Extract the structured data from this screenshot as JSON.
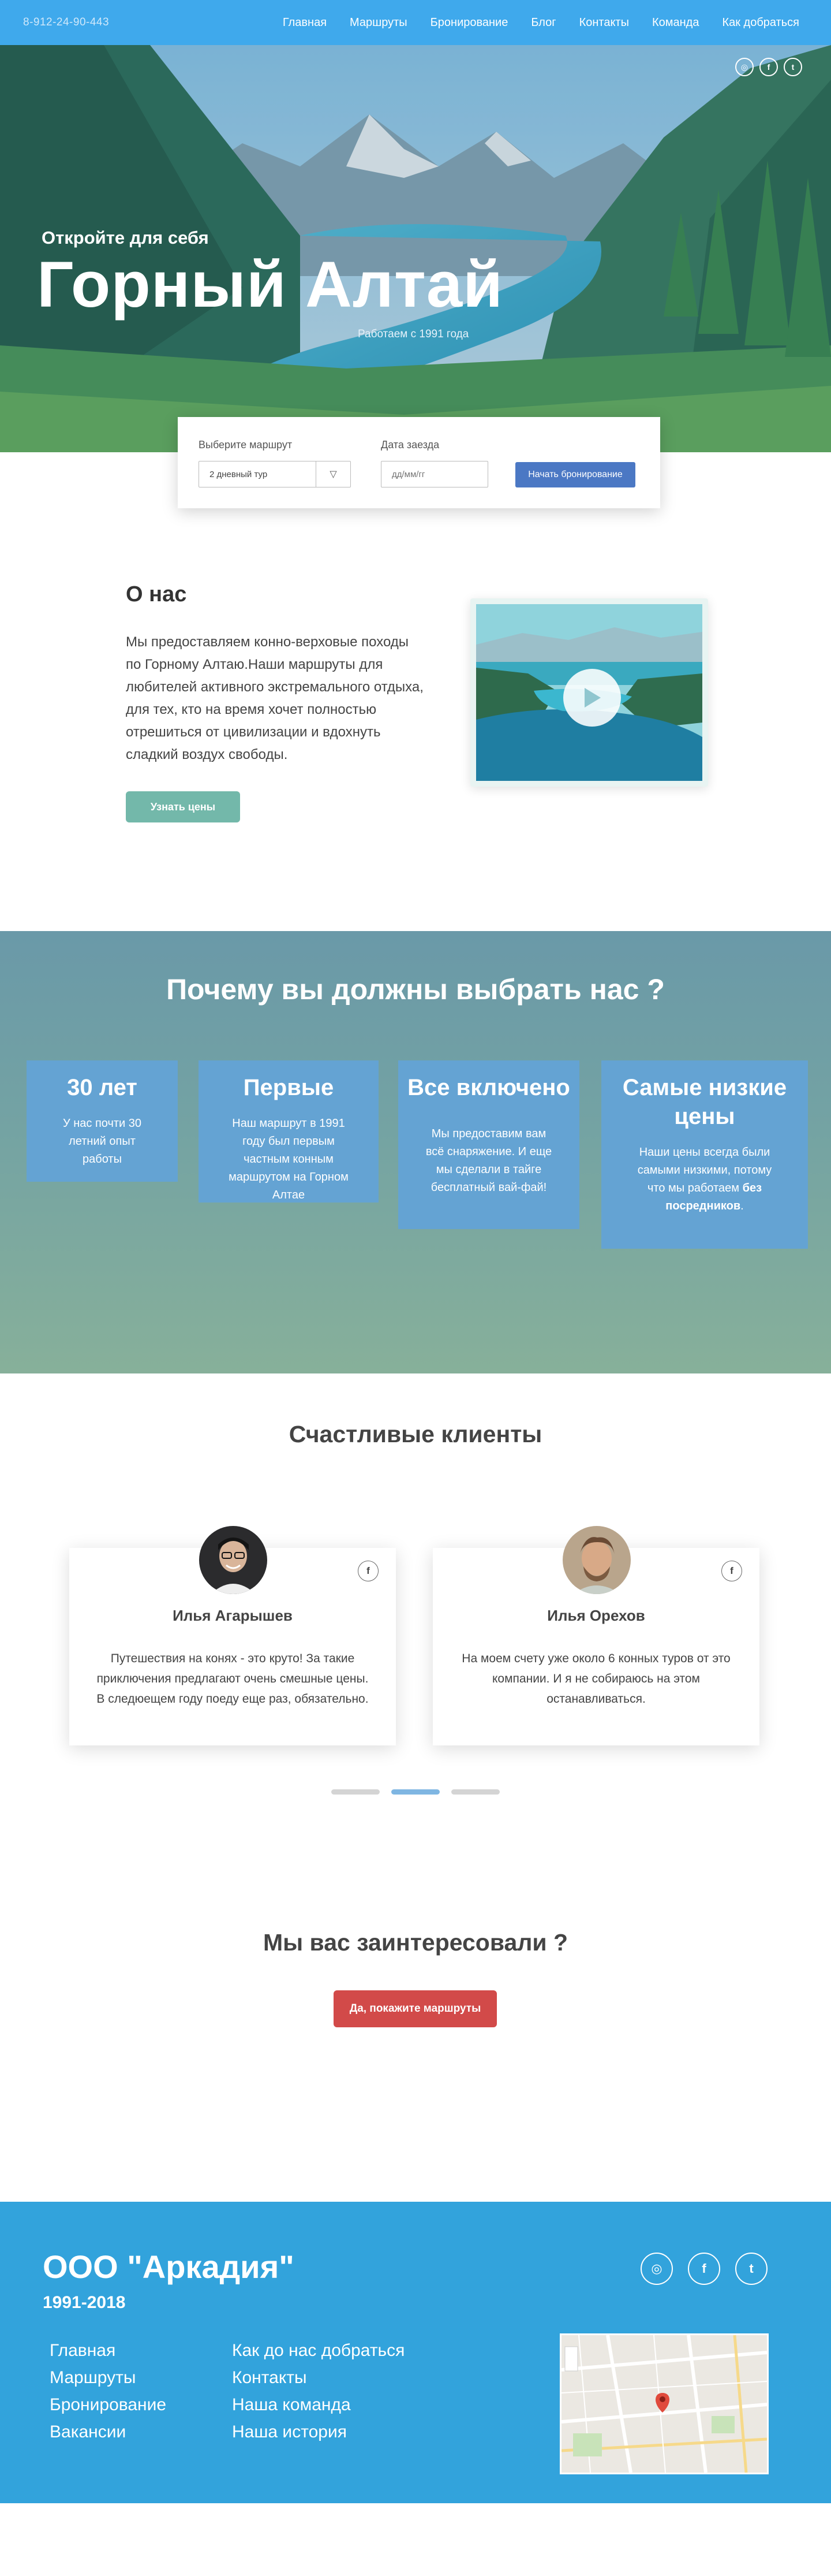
{
  "nav": {
    "phone": "8-912-24-90-443",
    "items": [
      "Главная",
      "Маршруты",
      "Бронирование",
      "Блог",
      "Контакты",
      "Команда",
      "Как добраться"
    ]
  },
  "hero": {
    "kicker": "Откройте для себя",
    "title": "Горный Алтай",
    "since": "Работаем с 1991 года",
    "socials": [
      "instagram-icon",
      "facebook-icon",
      "twitter-icon"
    ]
  },
  "booking": {
    "route_label": "Выберите маршрут",
    "route_value": "2 дневный тур",
    "date_label": "Дата заезда",
    "date_placeholder": "дд/мм/гг",
    "submit_label": "Начать бронирование"
  },
  "about": {
    "title": "О нас",
    "text": "Мы предоставляем конно-верховые походы по  Горному Алтаю.Наши маршруты для любителей активного экстремального отдыха, для тех, кто на время хочет полностью отрешиться от цивилизации и вдохнуть сладкий воздух свободы.",
    "button": "Узнать цены"
  },
  "why": {
    "title": "Почему вы должны выбрать нас ?",
    "cards": [
      {
        "heading": "30 лет",
        "text": "У нас  почти 30 летний опыт работы"
      },
      {
        "heading": "Первые",
        "text": "Наш маршрут в 1991 году был первым частным конным маршрутом на Горном Алтае"
      },
      {
        "heading": "Все включено",
        "text": "Мы предоставим вам всё снаряжение. И еще мы сделали в тайге бесплатный вай-фай!"
      },
      {
        "heading": "Самые низкие цены",
        "text": "Наши цены всегда были самыми низкими, потому что мы работаем",
        "text_bold": "без посредников",
        "text_end": "."
      }
    ]
  },
  "clients": {
    "title": "Счастливые клиенты",
    "reviews": [
      {
        "name": "Илья Агарышев",
        "text": "Путешествия на конях - это круто! За такие приключения предлагают очень смешные цены. В следюещем году поеду еще раз, обязательно."
      },
      {
        "name": "Илья Орехов",
        "text": "На моем счету уже около 6 конных туров от это компании. И я не собираюсь на этом останавливаться."
      }
    ],
    "active_slide": 2,
    "slide_count": 3
  },
  "cta": {
    "title": "Мы вас заинтересовали ?",
    "button": "Да, покажите маршруты"
  },
  "footer": {
    "company": "ООО \"Аркадия\"",
    "years": "1991-2018",
    "links_left": [
      "Главная",
      "Маршруты",
      "Бронирование",
      "Вакансии"
    ],
    "links_right": [
      "Как до нас добраться",
      "Контакты",
      "Наша команда",
      "Наша история"
    ],
    "socials": [
      "instagram-icon",
      "facebook-icon",
      "twitter-icon"
    ]
  },
  "colors": {
    "nav": "#3fa9ec",
    "booking_button": "#4b78c4",
    "price_button": "#73b8aa",
    "card": "#64a3d3",
    "cta_button": "#d24a49",
    "footer": "#32a3dc"
  }
}
